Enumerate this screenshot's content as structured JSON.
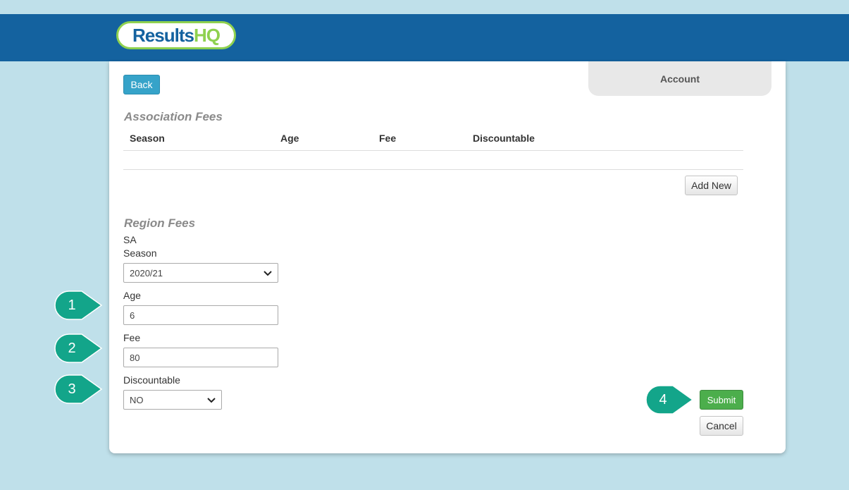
{
  "header": {
    "logo_part1": "Results",
    "logo_part2": "HQ",
    "account_label": "Account"
  },
  "back_label": "Back",
  "association": {
    "title": "Association Fees",
    "columns": [
      "Season",
      "Age",
      "Fee",
      "Discountable"
    ],
    "add_label": "Add New"
  },
  "region": {
    "title": "Region Fees",
    "region_name": "SA",
    "season_label": "Season",
    "season_value": "2020/21",
    "age_label": "Age",
    "age_value": "6",
    "fee_label": "Fee",
    "fee_value": "80",
    "discountable_label": "Discountable",
    "discountable_value": "NO"
  },
  "actions": {
    "submit_label": "Submit",
    "cancel_label": "Cancel"
  },
  "callouts": [
    "1",
    "2",
    "3",
    "4"
  ],
  "colors": {
    "header": "#14629f",
    "logo_accent": "#8fd14f",
    "callout": "#13a58a",
    "submit": "#4cae4c",
    "back": "#36a3c9"
  }
}
